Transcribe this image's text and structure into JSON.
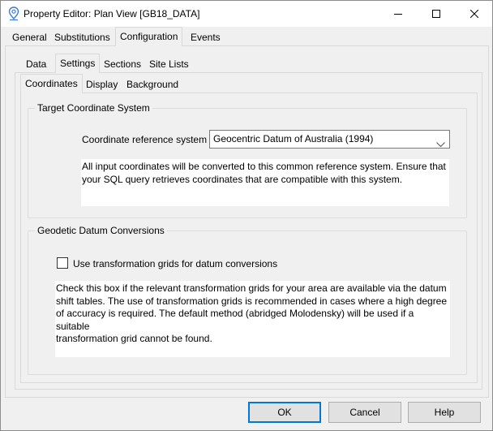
{
  "window": {
    "title": "Property Editor: Plan View [GB18_DATA]",
    "minimize_icon": "minimize-icon",
    "maximize_icon": "maximize-icon",
    "close_icon": "close-icon"
  },
  "tabs_level1": [
    {
      "label": "General",
      "active": false
    },
    {
      "label": "Substitutions",
      "active": false
    },
    {
      "label": "Configuration",
      "active": true
    },
    {
      "label": "Events",
      "active": false
    }
  ],
  "tabs_level2": [
    {
      "label": "Data",
      "active": false
    },
    {
      "label": "Settings",
      "active": true
    },
    {
      "label": "Sections",
      "active": false
    },
    {
      "label": "Site Lists",
      "active": false
    }
  ],
  "tabs_level3": [
    {
      "label": "Coordinates",
      "active": true
    },
    {
      "label": "Display",
      "active": false
    },
    {
      "label": "Background",
      "active": false
    }
  ],
  "target_group": {
    "title": "Target Coordinate System",
    "crs_label": "Coordinate reference system",
    "crs_value": "Geocentric Datum of Australia (1994)",
    "info_line1": "All input coordinates will be converted to this common reference system. Ensure that",
    "info_line2": "your SQL query retrieves coordinates that are compatible with this system."
  },
  "datum_group": {
    "title": "Geodetic Datum Conversions",
    "checkbox_label": "Use transformation grids for datum conversions",
    "checkbox_checked": false,
    "info_line1": "Check this box if the relevant transformation grids for your area are available via the datum",
    "info_line2": "shift tables. The use of transformation grids is recommended in cases where a high degree",
    "info_line3": "of accuracy is required. The default method (abridged Molodensky) will be used if a suitable",
    "info_line4": "transformation grid cannot be found."
  },
  "buttons": {
    "ok": "OK",
    "cancel": "Cancel",
    "help": "Help"
  },
  "colors": {
    "accent": "#0078d7",
    "app_icon": "#3a7bd5"
  }
}
